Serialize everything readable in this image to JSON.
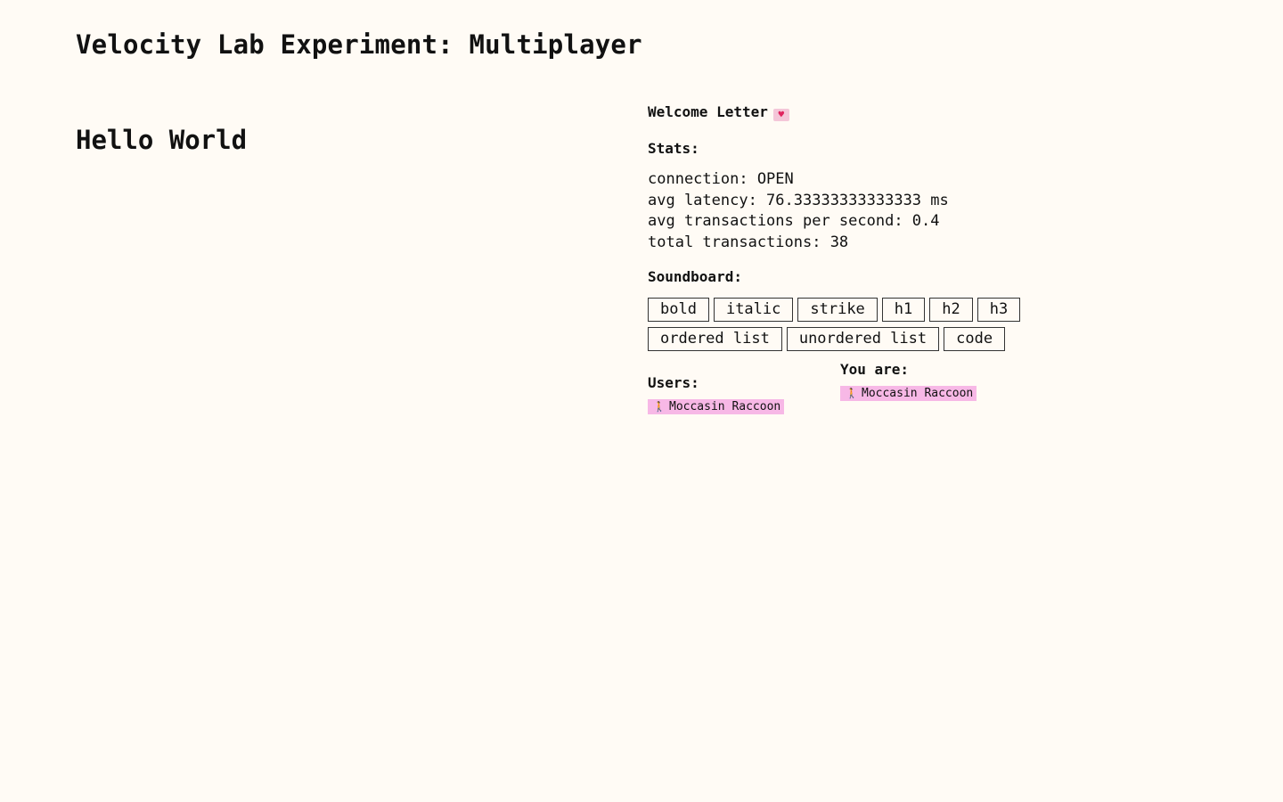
{
  "page": {
    "title": "Velocity Lab Experiment: Multiplayer"
  },
  "editor": {
    "heading": "Hello World"
  },
  "sidebar": {
    "welcome_label": "Welcome Letter",
    "welcome_icon": "love-letter-icon",
    "stats_label": "Stats:",
    "stats": [
      "connection: OPEN",
      "avg latency: 76.33333333333333 ms",
      "avg transactions per second: 0.4",
      "total transactions: 38"
    ],
    "soundboard_label": "Soundboard:",
    "buttons": [
      "bold",
      "italic",
      "strike",
      "h1",
      "h2",
      "h3",
      "ordered list",
      "unordered list",
      "code"
    ],
    "users_label": "Users:",
    "users": [
      {
        "name": "Moccasin Raccoon",
        "icon": "person-walking-icon",
        "color": "#f7b8e6"
      }
    ],
    "you_are_label": "You are:",
    "you": {
      "name": "Moccasin Raccoon",
      "icon": "person-walking-icon",
      "color": "#f7b8e6"
    }
  }
}
